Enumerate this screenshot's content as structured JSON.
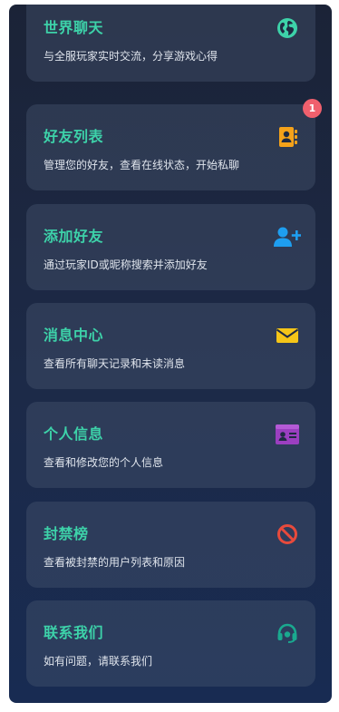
{
  "cards": [
    {
      "title": "世界聊天",
      "desc": "与全服玩家实时交流，分享游戏心得",
      "icon": "globe-icon",
      "icon_color": "#3dd2a9"
    },
    {
      "title": "好友列表",
      "desc": "管理您的好友，查看在线状态，开始私聊",
      "icon": "contacts-book-icon",
      "icon_color": "#f5a21a",
      "badge": "1"
    },
    {
      "title": "添加好友",
      "desc": "通过玩家ID或昵称搜索并添加好友",
      "icon": "add-user-icon",
      "icon_color": "#1e9ef0"
    },
    {
      "title": "消息中心",
      "desc": "查看所有聊天记录和未读消息",
      "icon": "envelope-icon",
      "icon_color": "#f5c518"
    },
    {
      "title": "个人信息",
      "desc": "查看和修改您的个人信息",
      "icon": "id-card-icon",
      "icon_color": "#9b3fc0"
    },
    {
      "title": "封禁榜",
      "desc": "查看被封禁的用户列表和原因",
      "icon": "ban-icon",
      "icon_color": "#e84a3c"
    },
    {
      "title": "联系我们",
      "desc": "如有问题，请联系我们",
      "icon": "headset-icon",
      "icon_color": "#1aa98f"
    }
  ],
  "colors": {
    "title": "#3dd2a9",
    "badge": "#f0606d"
  }
}
